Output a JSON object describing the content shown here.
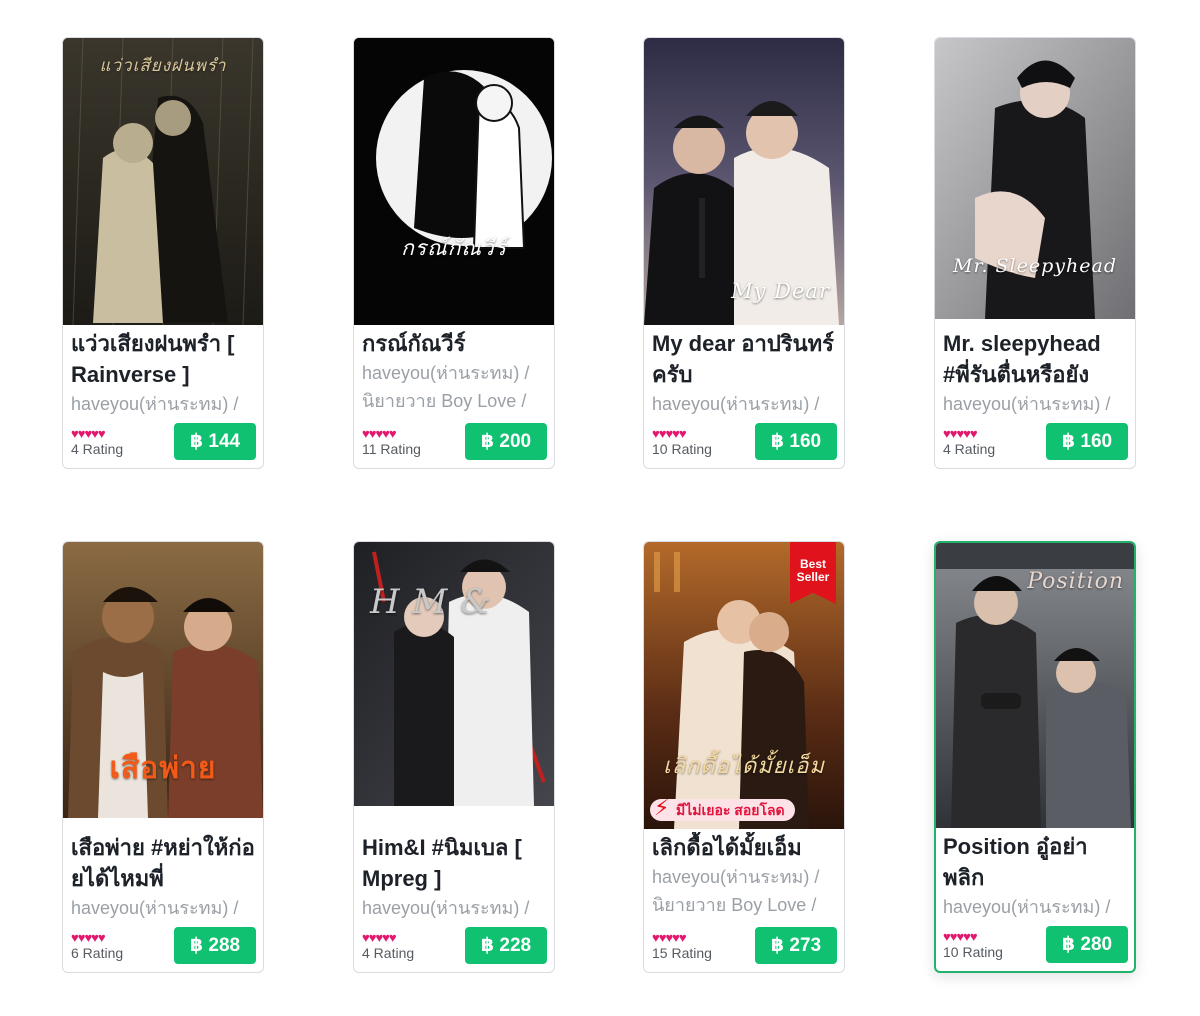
{
  "products": [
    {
      "title": "แว่วเสียงฝนพรำ [ Rainverse ]",
      "author": "haveyou(ห่านระทม) /",
      "category": "",
      "hearts": "♥♥♥♥♥",
      "rating": "4 Rating",
      "price": "฿ 144",
      "cover_title": "แว่วเสียงฝนพรำ",
      "cover_bg": "#2e2b24",
      "cover_fg": "#d9c79b"
    },
    {
      "title": "กรณ์กัณวีร์",
      "author": "haveyou(ห่านระทม) /",
      "category": "นิยายวาย Boy Love /",
      "hearts": "♥♥♥♥♥",
      "rating": "11 Rating",
      "price": "฿ 200",
      "cover_title": "กรณ์กัณวีร์",
      "cover_bg": "#050505",
      "cover_fg": "#ffffff"
    },
    {
      "title": "My dear อาปรินทร์ครับ",
      "author": "haveyou(ห่านระทม) /",
      "category": "",
      "hearts": "♥♥♥♥♥",
      "rating": "10 Rating",
      "price": "฿ 160",
      "cover_title": "My Dear",
      "cover_bg": "#4a4a66",
      "cover_fg": "#ffffff"
    },
    {
      "title": "Mr. sleepyhead #พี่รันตื่นหรือยัง",
      "author": "haveyou(ห่านระทม) /",
      "category": "",
      "hearts": "♥♥♥♥♥",
      "rating": "4 Rating",
      "price": "฿ 160",
      "cover_title": "Mr. Sleepyhead",
      "cover_bg": "#9d9da0",
      "cover_fg": "#ffffff"
    },
    {
      "title": "เสือพ่าย #หย่าให้ก่อยได้ไหมพี่",
      "author": "haveyou(ห่านระทม) /",
      "category": "",
      "hearts": "♥♥♥♥♥",
      "rating": "6 Rating",
      "price": "฿ 288",
      "cover_title": "เสือพ่าย",
      "cover_bg": "#5b3b22",
      "cover_fg": "#f25a17"
    },
    {
      "title": "Him&I #นิมเบล [ Mpreg ]",
      "author": "haveyou(ห่านระทม) /",
      "category": "",
      "hearts": "♥♥♥♥♥",
      "rating": "4 Rating",
      "price": "฿ 228",
      "cover_title": "H M &",
      "cover_bg": "#2b2c30",
      "cover_fg": "#c9c9c9"
    },
    {
      "title": "เลิกดื้อได้มั้ยเอ็ม",
      "author": "haveyou(ห่านระทม) /",
      "category": "นิยายวาย Boy Love /",
      "hearts": "♥♥♥♥♥",
      "rating": "15 Rating",
      "price": "฿ 273",
      "cover_title": "เลิกดื้อได้มั้ยเอ็ม",
      "cover_bg": "#5a2c15",
      "cover_fg": "#f4d9a0",
      "badge": "Best Seller",
      "promo": "มีไม่เยอะ สอยโลด"
    },
    {
      "title": "Position อู๋อย่าพลิก",
      "author": "haveyou(ห่านระทม) /",
      "category": "",
      "hearts": "♥♥♥♥♥",
      "rating": "10 Rating",
      "price": "฿ 280",
      "cover_title": "Position",
      "cover_bg": "#4e5257",
      "cover_fg": "#e8d7cf"
    }
  ],
  "colors": {
    "price_bg": "#10c172",
    "heart": "#e2186f",
    "selected_border": "#23b26b"
  }
}
